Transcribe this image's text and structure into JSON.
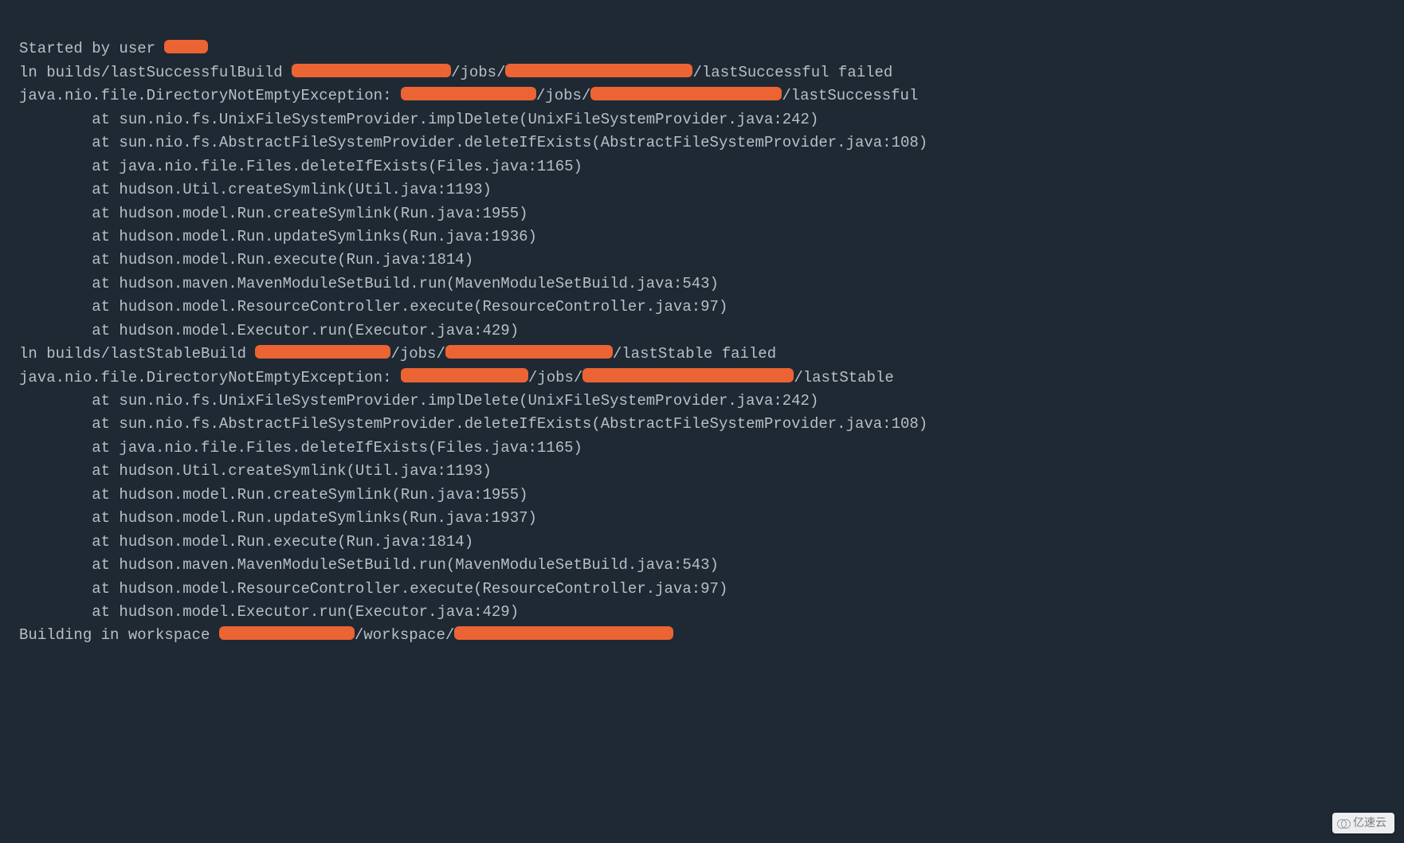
{
  "console": {
    "started": "Started by user ",
    "ln_success": {
      "prefix": "ln builds/lastSuccessfulBuild ",
      "jobs": "/jobs/",
      "suffix": "/lastSuccessful failed"
    },
    "exc_success": {
      "prefix": "java.nio.file.DirectoryNotEmptyException: ",
      "jobs": "/jobs/",
      "suffix": "/lastSuccessful"
    },
    "stack1": "        at sun.nio.fs.UnixFileSystemProvider.implDelete(UnixFileSystemProvider.java:242)\n        at sun.nio.fs.AbstractFileSystemProvider.deleteIfExists(AbstractFileSystemProvider.java:108)\n        at java.nio.file.Files.deleteIfExists(Files.java:1165)\n        at hudson.Util.createSymlink(Util.java:1193)\n        at hudson.model.Run.createSymlink(Run.java:1955)\n        at hudson.model.Run.updateSymlinks(Run.java:1936)\n        at hudson.model.Run.execute(Run.java:1814)\n        at hudson.maven.MavenModuleSetBuild.run(MavenModuleSetBuild.java:543)\n        at hudson.model.ResourceController.execute(ResourceController.java:97)\n        at hudson.model.Executor.run(Executor.java:429)",
    "ln_stable": {
      "prefix": "ln builds/lastStableBuild ",
      "jobs": "/jobs/",
      "suffix": "/lastStable failed"
    },
    "exc_stable": {
      "prefix": "java.nio.file.DirectoryNotEmptyException: ",
      "jobs": "/jobs/",
      "suffix": "/lastStable"
    },
    "stack2": "        at sun.nio.fs.UnixFileSystemProvider.implDelete(UnixFileSystemProvider.java:242)\n        at sun.nio.fs.AbstractFileSystemProvider.deleteIfExists(AbstractFileSystemProvider.java:108)\n        at java.nio.file.Files.deleteIfExists(Files.java:1165)\n        at hudson.Util.createSymlink(Util.java:1193)\n        at hudson.model.Run.createSymlink(Run.java:1955)\n        at hudson.model.Run.updateSymlinks(Run.java:1937)\n        at hudson.model.Run.execute(Run.java:1814)\n        at hudson.maven.MavenModuleSetBuild.run(MavenModuleSetBuild.java:543)\n        at hudson.model.ResourceController.execute(ResourceController.java:97)\n        at hudson.model.Executor.run(Executor.java:429)",
    "building": {
      "prefix": "Building in workspace ",
      "mid": "/workspace/"
    }
  },
  "watermark": "亿速云",
  "redactions": {
    "user_w": 55,
    "path_a_w": 200,
    "path_b_w": 235,
    "path_c_w": 170,
    "path_d_w": 240,
    "stable_a_w": 170,
    "stable_b_w": 210,
    "stable_c_w": 160,
    "stable_d_w": 265,
    "ws_a_w": 170,
    "ws_b_w": 275
  }
}
